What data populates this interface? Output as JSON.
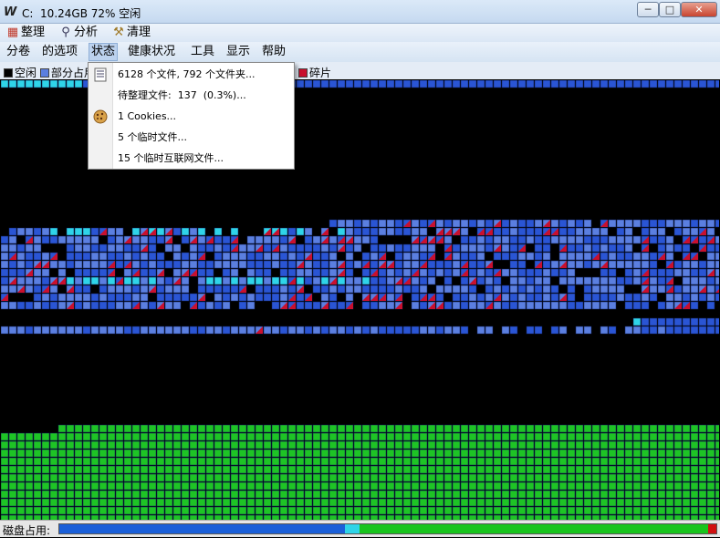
{
  "window": {
    "app_icon": "W",
    "title": "C:  10.24GB 72% 空闲",
    "controls": {
      "minimize": "─",
      "maximize": "□",
      "close": "✕"
    }
  },
  "toolbar": [
    {
      "label": "整理",
      "icon": "defrag-icon",
      "glyph": "⌘",
      "color": "#c0392b"
    },
    {
      "label": "分析",
      "icon": "magnifier-icon",
      "glyph": "🔍",
      "color": "#335"
    },
    {
      "label": "清理",
      "icon": "broom-icon",
      "glyph": "🧹",
      "color": "#a07b2a"
    }
  ],
  "menu": [
    {
      "label": "分卷",
      "id": "volume"
    },
    {
      "label": "的选项",
      "id": "options"
    },
    {
      "label": "状态",
      "id": "status",
      "active": true
    },
    {
      "label": "健康状况",
      "id": "health"
    },
    {
      "label": "工具",
      "id": "tools"
    },
    {
      "label": "显示",
      "id": "display"
    },
    {
      "label": "帮助",
      "id": "help"
    }
  ],
  "legend": [
    {
      "label": "空闲",
      "color": "#000000"
    },
    {
      "label": "部分占用",
      "color": "#5b7fe0"
    },
    {
      "label": "碎片",
      "color": "#c8102e"
    }
  ],
  "status_menu": [
    {
      "text": "6128 个文件, 792 个文件夹...",
      "icon": "file-list-icon"
    },
    {
      "text": "待整理文件:  137  (0.3%)...",
      "icon": ""
    },
    {
      "text": "1 Cookies...",
      "icon": "cookie-icon"
    },
    {
      "text": "5 个临时文件...",
      "icon": ""
    },
    {
      "text": "15 个临时互联网文件...",
      "icon": ""
    }
  ],
  "statusbar": {
    "usage_label": "磁盘占用:",
    "segments": [
      {
        "name": "used",
        "color": "#1a5fd8",
        "fraction": 0.435
      },
      {
        "name": "system",
        "color": "#2fd4e8",
        "fraction": 0.022
      },
      {
        "name": "free-green",
        "color": "#19c41d",
        "fraction": 0.53
      },
      {
        "name": "fragmented",
        "color": "#d01010",
        "fraction": 0.013
      }
    ]
  },
  "colors": {
    "free": "#000000",
    "used": "#2a55d4",
    "partial": "#5b7fe0",
    "system": "#2fd4e8",
    "fragment": "#c8102e",
    "green": "#1ec425",
    "grid": "#10205a"
  }
}
